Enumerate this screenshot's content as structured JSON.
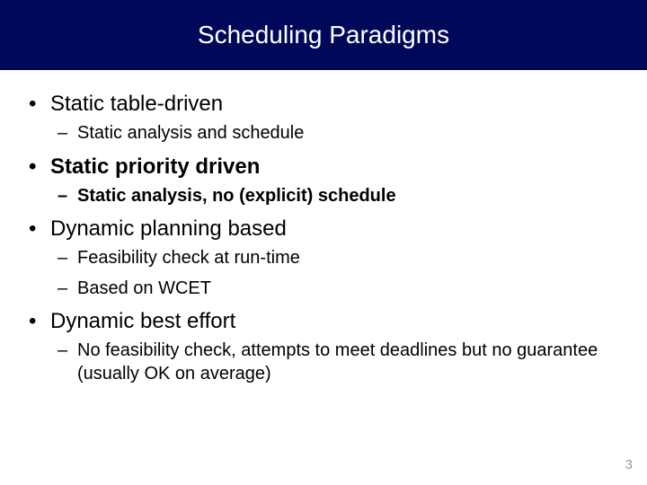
{
  "title": "Scheduling Paradigms",
  "items": [
    {
      "text": "Static table-driven",
      "bold": false,
      "sub": [
        {
          "text": "Static analysis and schedule",
          "bold": false
        }
      ]
    },
    {
      "text": "Static priority driven",
      "bold": true,
      "sub": [
        {
          "text": "Static analysis, no (explicit) schedule",
          "bold": true
        }
      ]
    },
    {
      "text": "Dynamic planning based",
      "bold": false,
      "sub": [
        {
          "text": "Feasibility check at run-time",
          "bold": false
        },
        {
          "text": "Based on WCET",
          "bold": false
        }
      ]
    },
    {
      "text": "Dynamic best effort",
      "bold": false,
      "sub": [
        {
          "text": "No feasibility check, attempts to meet deadlines but no guarantee (usually OK on average)",
          "bold": false
        }
      ]
    }
  ],
  "glyphs": {
    "dot": "•",
    "dash": "–"
  },
  "page_number": "3"
}
